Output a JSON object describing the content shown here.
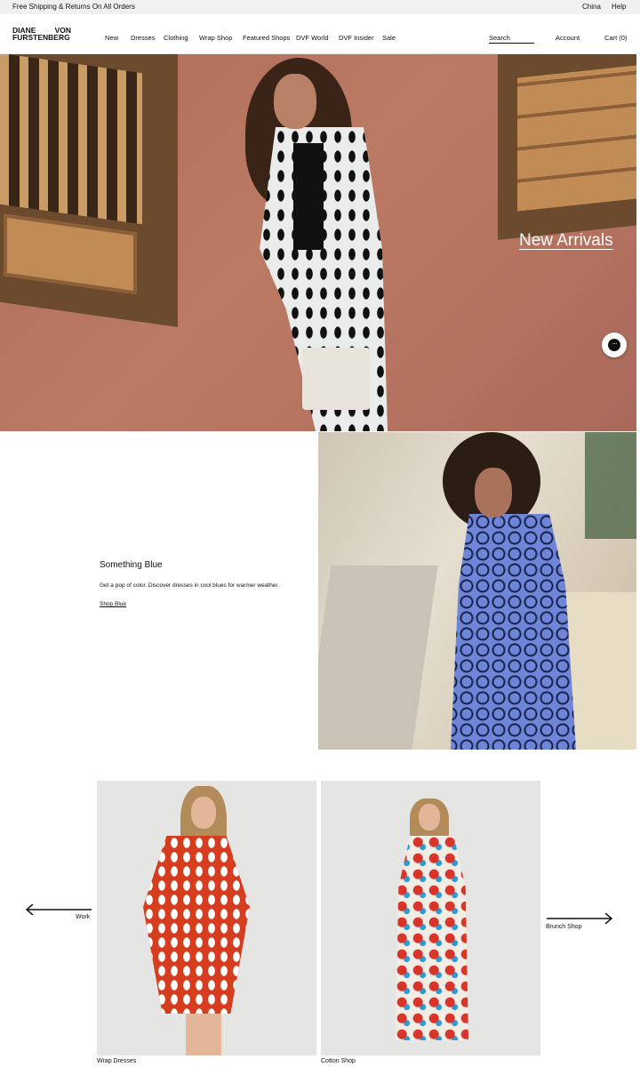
{
  "promo_bar": {
    "message": "Free Shipping & Returns On All Orders",
    "region": "China",
    "help": "Help"
  },
  "header": {
    "logo": {
      "line1_left": "DIANE",
      "line1_right": "VON",
      "line2": "FURSTENBERG"
    },
    "nav": [
      "New",
      "Dresses",
      "Clothing",
      "Wrap Shop",
      "Featured Shops",
      "DVF World",
      "DVF Insider",
      "Sale"
    ],
    "search_placeholder": "Search",
    "account": "Account",
    "cart": "Cart (0)"
  },
  "hero": {
    "headline": "New Arrivals",
    "colors": {
      "wall": "#b5735f",
      "text": "#ffffff"
    }
  },
  "feature": {
    "title": "Something Blue",
    "description": "Get a pop of color. Discover dresses in cool blues for warmer weather.",
    "link": "Shop Blue"
  },
  "carousel": {
    "prev_label": "Work",
    "next_label": "Brunch Shop",
    "cards": [
      {
        "label": "Wrap Dresses"
      },
      {
        "label": "Cotton Shop"
      }
    ]
  },
  "icons": {
    "chat": "chat-bubble-icon",
    "prev": "arrow-left-icon",
    "next": "arrow-right-icon"
  }
}
